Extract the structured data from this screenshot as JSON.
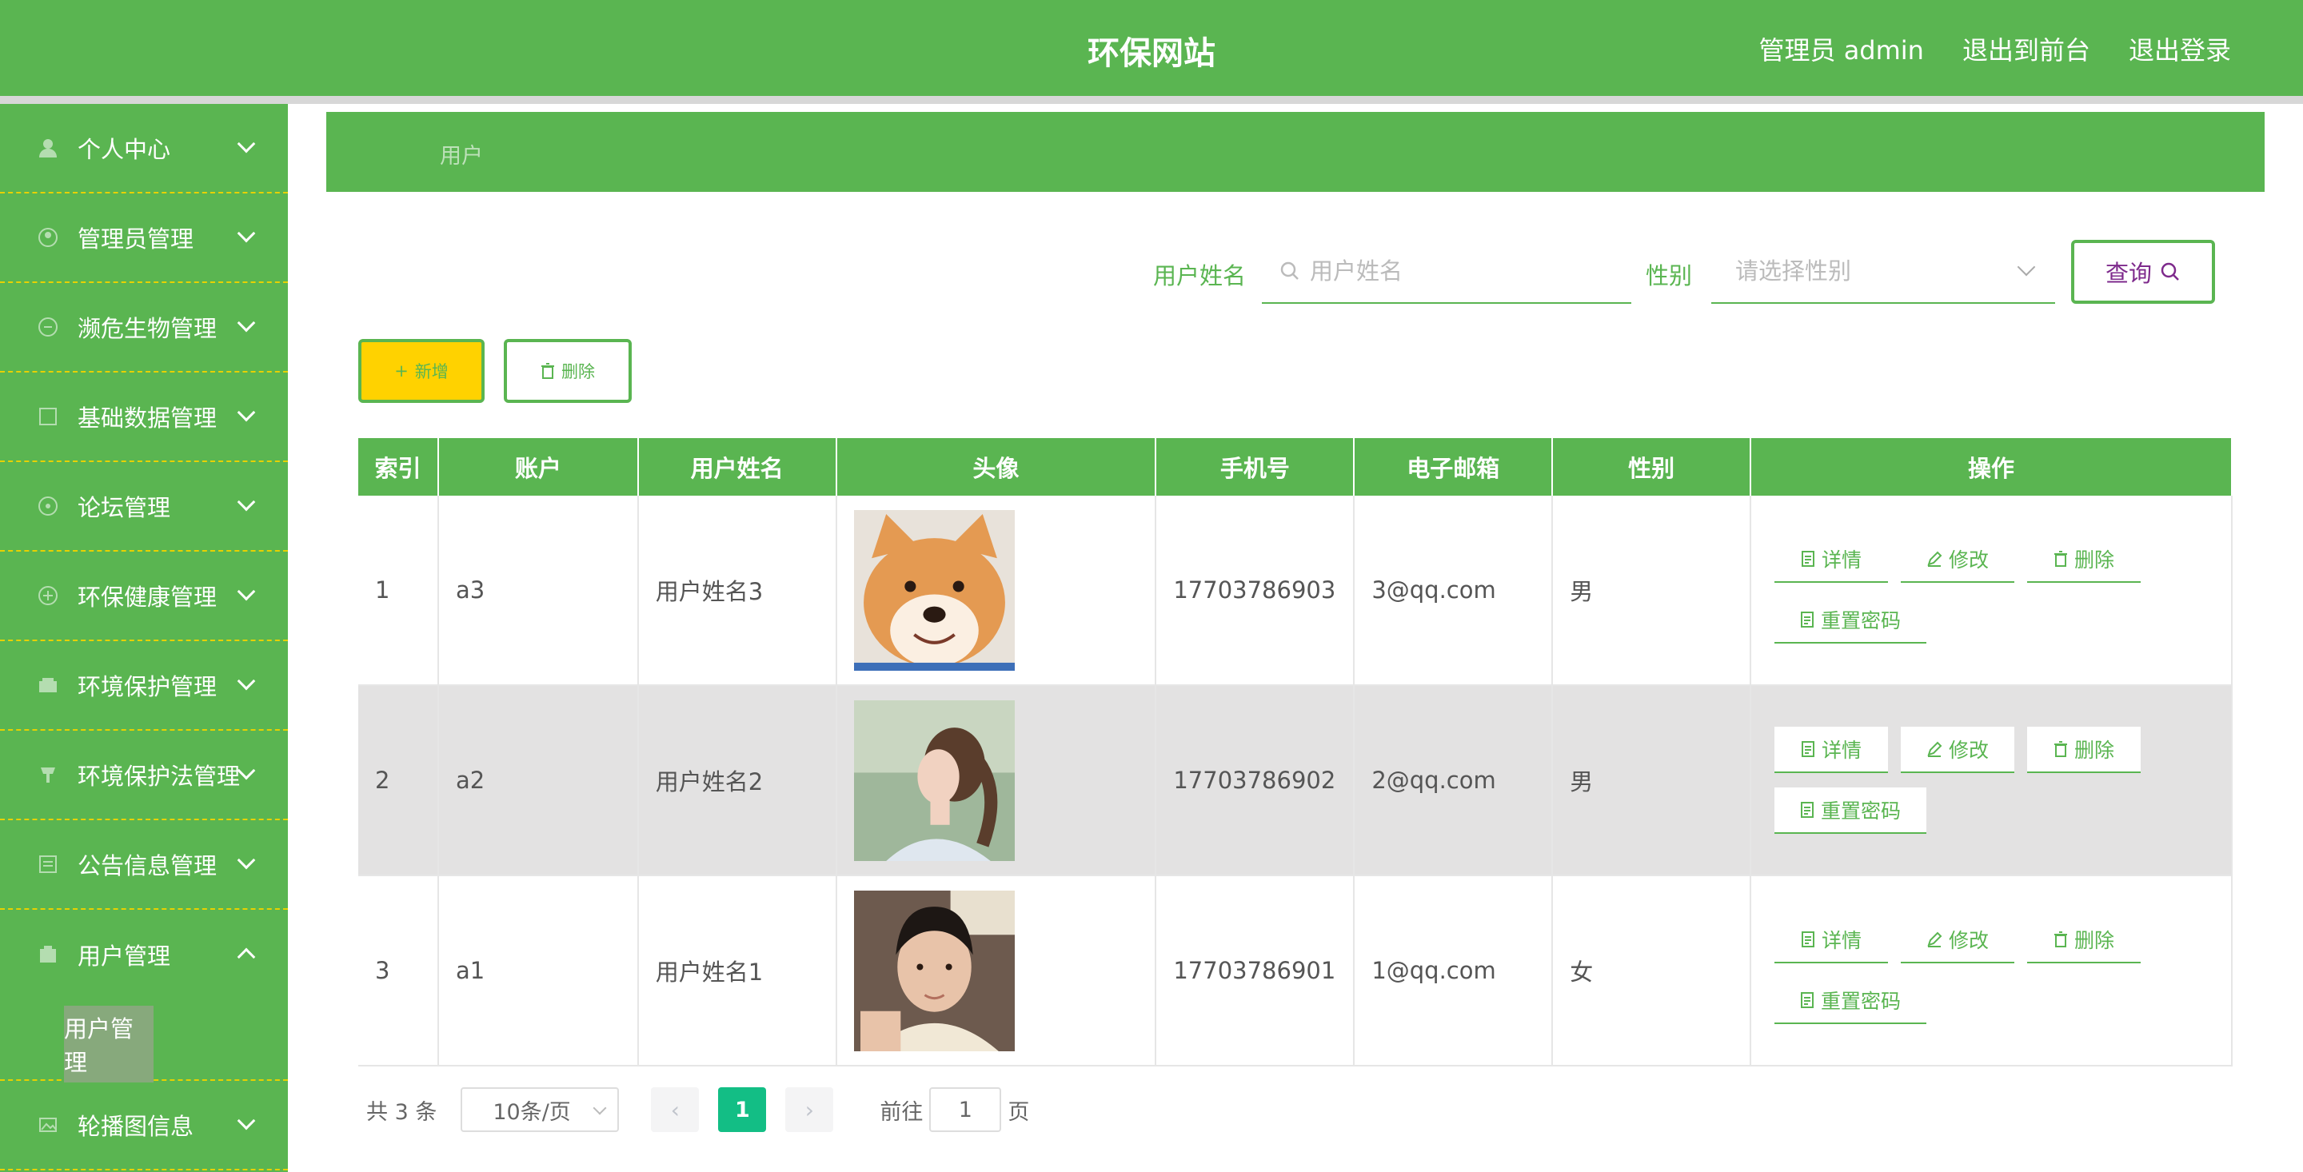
{
  "header": {
    "title": "环保网站",
    "admin_label": "管理员 admin",
    "to_front": "退出到前台",
    "logout": "退出登录"
  },
  "sidebar": {
    "items": [
      {
        "label": "个人中心",
        "icon": "user-icon"
      },
      {
        "label": "管理员管理",
        "icon": "admin-icon"
      },
      {
        "label": "濒危生物管理",
        "icon": "species-icon"
      },
      {
        "label": "基础数据管理",
        "icon": "data-icon"
      },
      {
        "label": "论坛管理",
        "icon": "forum-icon"
      },
      {
        "label": "环保健康管理",
        "icon": "health-icon"
      },
      {
        "label": "环境保护管理",
        "icon": "environment-icon"
      },
      {
        "label": "环境保护法管理",
        "icon": "law-icon"
      },
      {
        "label": "公告信息管理",
        "icon": "notice-icon"
      },
      {
        "label": "用户管理",
        "icon": "users-icon",
        "submenu": "用户管理"
      },
      {
        "label": "轮播图信息",
        "icon": "carousel-icon"
      }
    ]
  },
  "breadcrumb": "用户",
  "search": {
    "name_label": "用户姓名",
    "name_placeholder": "用户姓名",
    "gender_label": "性别",
    "gender_placeholder": "请选择性别",
    "query_label": "查询"
  },
  "actions": {
    "add": "新增",
    "delete": "删除"
  },
  "table": {
    "headers": [
      "索引",
      "账户",
      "用户姓名",
      "头像",
      "手机号",
      "电子邮箱",
      "性别",
      "操作"
    ],
    "rows": [
      {
        "index": "1",
        "account": "a3",
        "name": "用户姓名3",
        "avatar": "shiba-dog-photo",
        "phone": "17703786903",
        "email": "3@qq.com",
        "gender": "男"
      },
      {
        "index": "2",
        "account": "a2",
        "name": "用户姓名2",
        "avatar": "girl-profile-photo",
        "phone": "17703786902",
        "email": "2@qq.com",
        "gender": "男"
      },
      {
        "index": "3",
        "account": "a1",
        "name": "用户姓名1",
        "avatar": "boy-portrait-photo",
        "phone": "17703786901",
        "email": "1@qq.com",
        "gender": "女"
      }
    ],
    "ops": {
      "detail": "详情",
      "edit": "修改",
      "delete": "删除",
      "reset": "重置密码"
    }
  },
  "pagination": {
    "total": "共 3 条",
    "page_size": "10条/页",
    "current": "1",
    "goto_prefix": "前往",
    "goto_value": "1",
    "goto_suffix": "页"
  },
  "colors": {
    "primary": "#5ab551",
    "accent": "#ffd200",
    "current_page": "#13be85"
  }
}
